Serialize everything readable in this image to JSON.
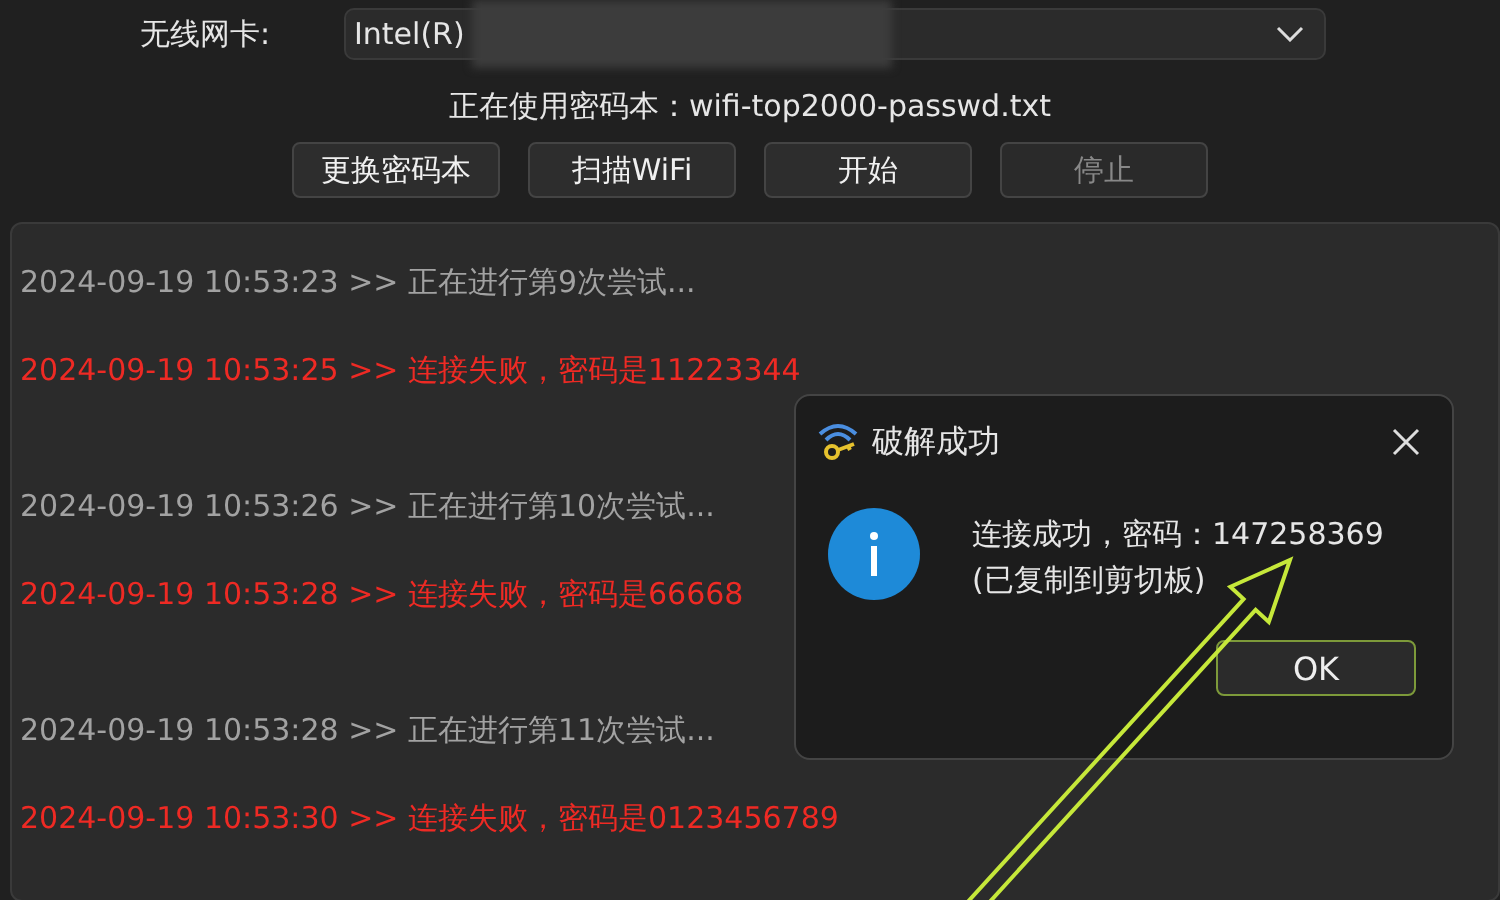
{
  "adapter": {
    "label": "无线网卡:",
    "value": "Intel(R)"
  },
  "wordlist": {
    "text": "正在使用密码本：wifi-top2000-passwd.txt"
  },
  "buttons": [
    {
      "label": "更换密码本",
      "disabled": false
    },
    {
      "label": "扫描WiFi",
      "disabled": false
    },
    {
      "label": "开始",
      "disabled": false
    },
    {
      "label": "停止",
      "disabled": true
    }
  ],
  "log": [
    {
      "kind": "info",
      "text": "2024-09-19 10:53:23 >> 正在进行第9次尝试..."
    },
    {
      "kind": "error",
      "text": "2024-09-19 10:53:25 >> 连接失败，密码是11223344"
    },
    {
      "kind": "info",
      "text": "2024-09-19 10:53:26 >> 正在进行第10次尝试..."
    },
    {
      "kind": "error",
      "text": "2024-09-19 10:53:28 >> 连接失败，密码是66668"
    },
    {
      "kind": "info",
      "text": "2024-09-19 10:53:28 >> 正在进行第11次尝试..."
    },
    {
      "kind": "error",
      "text": "2024-09-19 10:53:30 >> 连接失败，密码是0123456789"
    }
  ],
  "dialog": {
    "title": "破解成功",
    "message": "连接成功，密码：147258369",
    "note": "(已复制到剪切板)",
    "button": "OK"
  }
}
